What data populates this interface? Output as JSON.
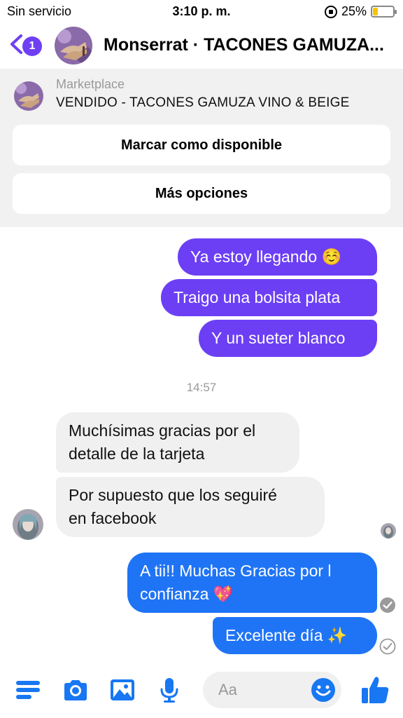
{
  "status_bar": {
    "carrier": "Sin servicio",
    "time": "3:10 p. m.",
    "battery_percent": "25%",
    "battery_level": 0.25
  },
  "header": {
    "back_badge": "1",
    "title": "Monserrat · TACONES GAMUZA..."
  },
  "marketplace": {
    "label": "Marketplace",
    "item_title": "VENDIDO - TACONES GAMUZA VINO & BEIGE",
    "mark_available_label": "Marcar como disponible",
    "more_options_label": "Más opciones"
  },
  "messages": {
    "m1": "Ya estoy llegando ☺️",
    "m2": "Traigo una bolsita plata",
    "m3": "Y un sueter blanco",
    "timestamp": "14:57",
    "m4_line1": "Muchísimas gracias por el",
    "m4_line2": "detalle de la tarjeta",
    "m5_line1": "Por supuesto que los seguiré",
    "m5_line2": "en facebook",
    "m6_line1": "A tii!! Muchas Gracias por l",
    "m6_line2": "confianza 💖",
    "m7": "Excelente día ✨"
  },
  "composer": {
    "placeholder": "Aa"
  },
  "colors": {
    "accent_purple": "#6c3ff5",
    "accent_blue": "#1f74f5",
    "toolbar_icon_blue": "#1877f2",
    "incoming_bubble": "#f0f0f0"
  },
  "icons": [
    "back-chevron-icon",
    "menu-icon",
    "camera-icon",
    "photo-icon",
    "microphone-icon",
    "emoji-icon",
    "thumbs-up-icon",
    "check-circle-icon"
  ]
}
